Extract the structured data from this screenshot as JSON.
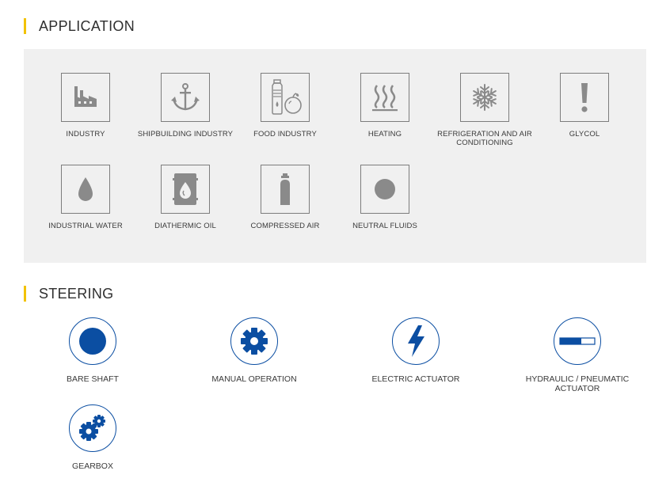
{
  "application": {
    "title": "APPLICATION",
    "items": [
      {
        "label": "INDUSTRY",
        "icon": "factory-icon"
      },
      {
        "label": "SHIPBUILDING INDUSTRY",
        "icon": "anchor-icon"
      },
      {
        "label": "FOOD INDUSTRY",
        "icon": "food-icon"
      },
      {
        "label": "HEATING",
        "icon": "heat-waves-icon"
      },
      {
        "label": "REFRIGERATION AND AIR CONDITIONING",
        "icon": "snowflake-icon"
      },
      {
        "label": "GLYCOL",
        "icon": "exclamation-icon"
      },
      {
        "label": "INDUSTRIAL WATER",
        "icon": "water-drop-icon"
      },
      {
        "label": "DIATHERMIC OIL",
        "icon": "oil-barrel-icon"
      },
      {
        "label": "COMPRESSED AIR",
        "icon": "gas-cylinder-icon"
      },
      {
        "label": "NEUTRAL FLUIDS",
        "icon": "dot-icon"
      }
    ]
  },
  "steering": {
    "title": "STEERING",
    "items": [
      {
        "label": "BARE SHAFT",
        "icon": "filled-circle-icon"
      },
      {
        "label": "MANUAL OPERATION",
        "icon": "gear-icon"
      },
      {
        "label": "ELECTRIC ACTUATOR",
        "icon": "lightning-icon"
      },
      {
        "label": "HYDRAULIC / PNEUMATIC ACTUATOR",
        "icon": "piston-icon"
      },
      {
        "label": "GEARBOX",
        "icon": "gears-icon"
      }
    ]
  },
  "colors": {
    "accent": "#f2c200",
    "steering_blue": "#0b4ea2",
    "icon_gray": "#8a8a8a",
    "panel_bg": "#f0f0f0"
  }
}
